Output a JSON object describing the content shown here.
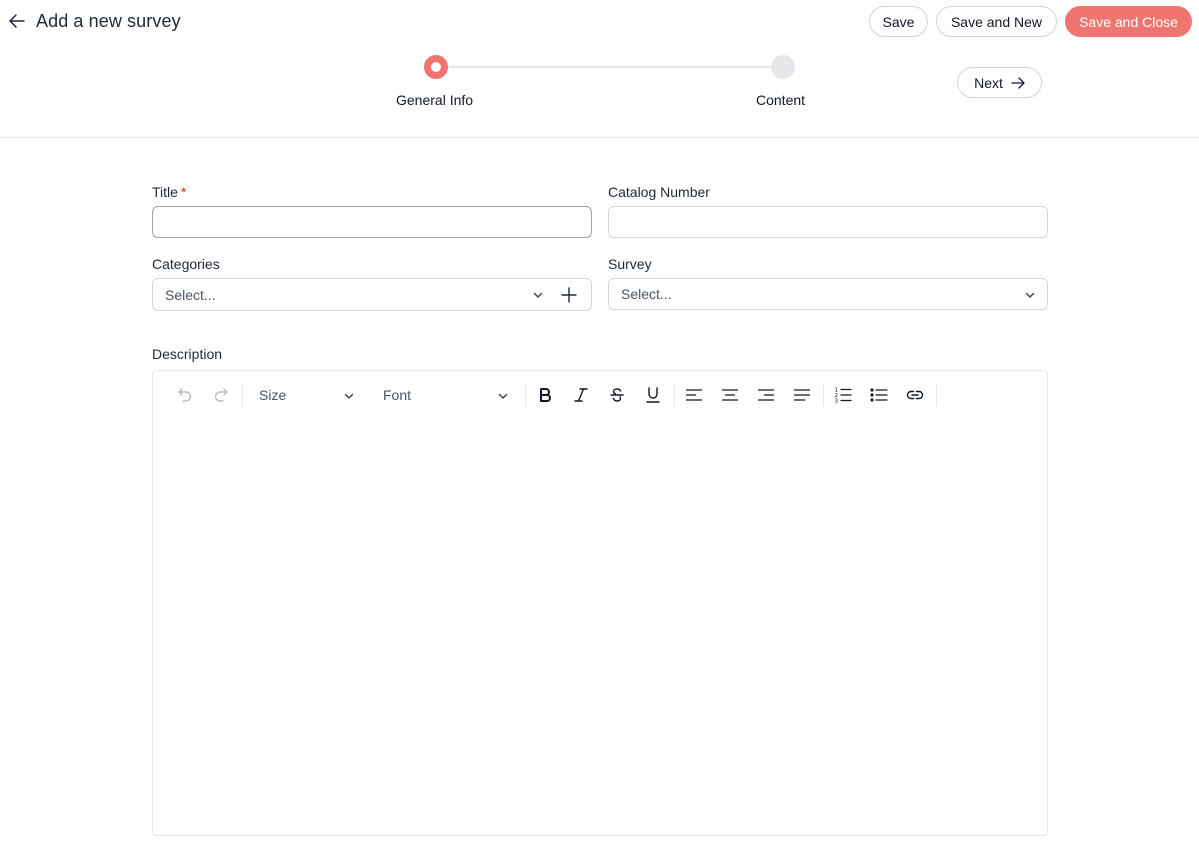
{
  "header": {
    "title": "Add a new survey",
    "back_icon": "arrow-left-icon",
    "save_label": "Save",
    "save_new_label": "Save and New",
    "save_close_label": "Save and Close"
  },
  "stepper": {
    "steps": [
      {
        "label": "General Info",
        "active": true
      },
      {
        "label": "Content",
        "active": false
      }
    ],
    "next_label": "Next"
  },
  "form": {
    "title_label": "Title",
    "required_mark": "*",
    "title_value": "",
    "catalog_label": "Catalog Number",
    "catalog_value": "",
    "categories_label": "Categories",
    "categories_placeholder": "Select...",
    "survey_label": "Survey",
    "survey_placeholder": "Select...",
    "description_label": "Description"
  },
  "editor": {
    "size_label": "Size",
    "font_label": "Font",
    "tools": [
      "undo-icon",
      "redo-icon",
      "bold-icon",
      "italic-icon",
      "strikethrough-icon",
      "underline-icon",
      "align-left-icon",
      "align-center-icon",
      "align-right-icon",
      "align-justify-icon",
      "ordered-list-icon",
      "bullet-list-icon",
      "link-icon"
    ]
  },
  "colors": {
    "accent": "#f07470",
    "inactive_step": "#e5e7eb",
    "required": "#dc2626"
  }
}
